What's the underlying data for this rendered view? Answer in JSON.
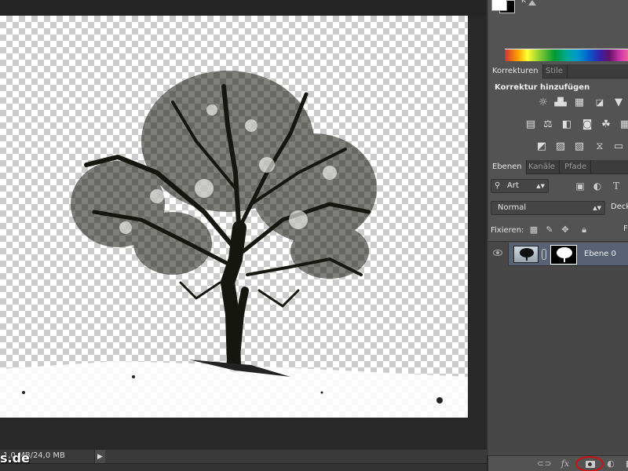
{
  "color_panel": {
    "foreground_color": "#ffffff",
    "background_color": "#000000",
    "slider_label": "K"
  },
  "adjustments_panel": {
    "tabs": [
      {
        "label": "Korrekturen",
        "active": true
      },
      {
        "label": "Stile",
        "active": false
      }
    ],
    "title": "Korrektur hinzufügen",
    "icons": [
      [
        "brightness-contrast-icon",
        "levels-icon",
        "curves-icon",
        "exposure-icon",
        "vibrance-icon"
      ],
      [
        "hue-saturation-icon",
        "color-balance-icon",
        "black-white-icon",
        "photo-filter-icon",
        "channel-mixer-icon",
        "color-lookup-icon"
      ],
      [
        "invert-icon",
        "posterize-icon",
        "threshold-icon",
        "selective-color-icon",
        "gradient-map-icon"
      ]
    ]
  },
  "layers_panel": {
    "tabs": [
      {
        "label": "Ebenen",
        "active": true
      },
      {
        "label": "Kanäle",
        "active": false
      },
      {
        "label": "Pfade",
        "active": false
      }
    ],
    "filter": {
      "label": "Art"
    },
    "blend_mode": "Normal",
    "opacity_label": "Deck",
    "lock_label": "Fixieren:",
    "fill_label": "Fl",
    "layers": [
      {
        "name": "Ebene 0",
        "visible": true,
        "has_mask": true,
        "selected": true
      }
    ],
    "bottom_icons": [
      "link-icon",
      "fx-icon",
      "add-mask-icon",
      "adjustment-layer-icon",
      "new-group-icon"
    ],
    "fx_label": "fx",
    "highlight_color": "#d01010"
  },
  "status_bar": {
    "doc_size": "1,0 MB/24,0 MB",
    "arrow": "▶"
  },
  "watermark": "s.de"
}
